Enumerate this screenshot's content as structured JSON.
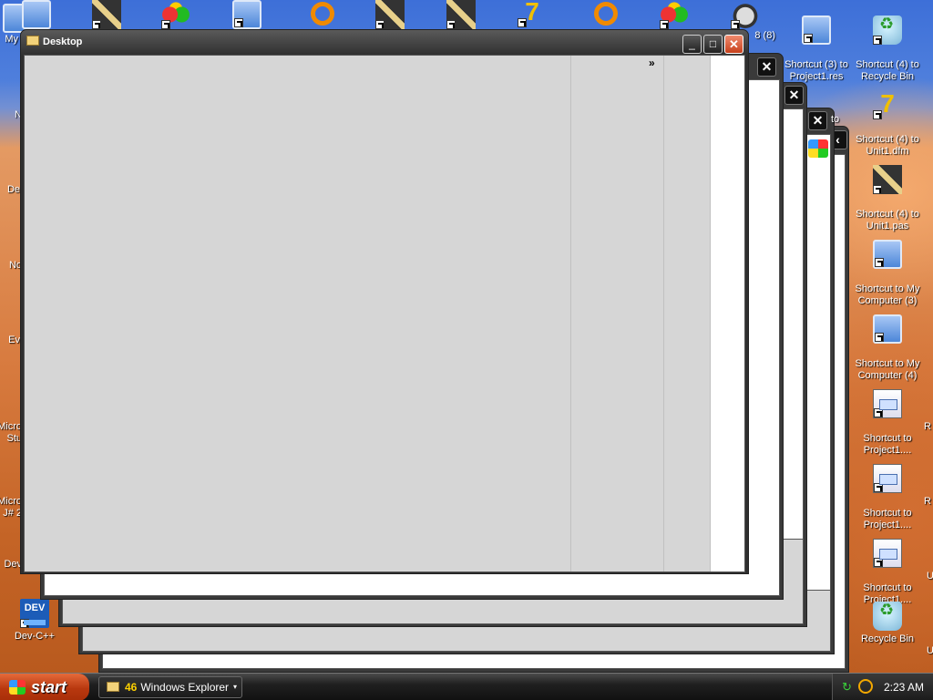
{
  "desktop": {
    "left_icons": [
      {
        "label": "My",
        "glyph": "computer-icon"
      },
      {
        "label": "N",
        "glyph": "document-icon"
      },
      {
        "label": "De",
        "glyph": "document-icon"
      },
      {
        "label": "No",
        "glyph": "document-icon"
      },
      {
        "label": "Ev",
        "glyph": "document-icon"
      },
      {
        "label": "Micro\nStu",
        "glyph": "document-icon"
      },
      {
        "label": "Micro\nJ# 2",
        "glyph": "document-icon"
      },
      {
        "label": "Dev",
        "glyph": "document-icon"
      },
      {
        "label": "Dev-C++",
        "glyph": "dev-cpp-icon"
      }
    ],
    "top_icons": [
      {
        "label": "",
        "glyph": "computer-icon"
      },
      {
        "label": "",
        "glyph": "pencil-icon"
      },
      {
        "label": "",
        "glyph": "butterfly-icon"
      },
      {
        "label": "",
        "glyph": "computer-icon"
      },
      {
        "label": "",
        "glyph": "ring-icon"
      },
      {
        "label": "",
        "glyph": "pencil-icon"
      },
      {
        "label": "",
        "glyph": "pencil-icon"
      },
      {
        "label": "",
        "glyph": "seven-icon"
      },
      {
        "label": "",
        "glyph": "ring-icon"
      },
      {
        "label": "",
        "glyph": "butterfly-icon"
      },
      {
        "label": "8 (8)",
        "glyph": "raccoon-icon"
      },
      {
        "label": "Shortcut (3) to\nProject1.res",
        "glyph": "computer-icon"
      },
      {
        "label": "Shortcut (4) to\nRecycle Bin",
        "glyph": "recycle-icon"
      }
    ],
    "right_icons": [
      {
        "label": "Shortcut (4) to\nUnit1.dfm",
        "glyph": "seven-icon"
      },
      {
        "label": "Shortcut (4) to\nUnit1.pas",
        "glyph": "pencil-icon"
      },
      {
        "label": "Shortcut to My\nComputer (3)",
        "glyph": "computer-icon"
      },
      {
        "label": "Shortcut to My\nComputer (4)",
        "glyph": "computer-icon"
      },
      {
        "label": "Shortcut to\nProject1....",
        "glyph": "paper-icon"
      },
      {
        "label": "Shortcut to\nProject1....",
        "glyph": "paper-icon"
      },
      {
        "label": "Shortcut to\nProject1....",
        "glyph": "paper-icon"
      },
      {
        "label": "Recycle Bin",
        "glyph": "recycle-icon"
      }
    ],
    "partial_right_edge_text": [
      "R",
      "R",
      "U",
      "U"
    ],
    "stub_tail_text": "to"
  },
  "window": {
    "title": "Desktop",
    "chevron": "»",
    "minimize": "_",
    "maximize": "□",
    "close": "✕",
    "back_close": "✕",
    "collapse": "‹"
  },
  "taskbar": {
    "start_label": "start",
    "group_count": "46",
    "group_label": "Windows Explorer",
    "group_dropdown": "▾",
    "clock": "2:23 AM",
    "tray_arrow": "↻"
  }
}
